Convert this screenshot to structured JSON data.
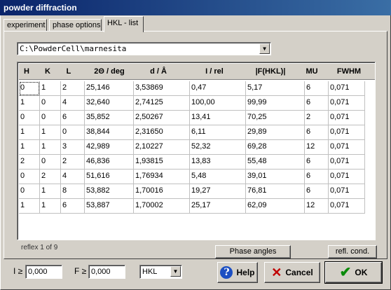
{
  "window": {
    "title": "powder diffraction"
  },
  "tabs": [
    {
      "label": "experiment"
    },
    {
      "label": "phase options"
    },
    {
      "label": "HKL - list"
    }
  ],
  "file_combo": {
    "value": "C:\\PowderCell\\marnesita",
    "icon": "chevron-down-icon"
  },
  "table": {
    "headers": [
      "H",
      "K",
      "L",
      "2Θ / deg",
      "d / Å",
      "I / rel",
      "|F(HKL)|",
      "MU",
      "FWHM"
    ],
    "rows": [
      [
        "0",
        "1",
        "2",
        "25,146",
        "3,53869",
        "0,47",
        "5,17",
        "6",
        "0,071"
      ],
      [
        "1",
        "0",
        "4",
        "32,640",
        "2,74125",
        "100,00",
        "99,99",
        "6",
        "0,071"
      ],
      [
        "0",
        "0",
        "6",
        "35,852",
        "2,50267",
        "13,41",
        "70,25",
        "2",
        "0,071"
      ],
      [
        "1",
        "1",
        "0",
        "38,844",
        "2,31650",
        "6,11",
        "29,89",
        "6",
        "0,071"
      ],
      [
        "1",
        "1",
        "3",
        "42,989",
        "2,10227",
        "52,32",
        "69,28",
        "12",
        "0,071"
      ],
      [
        "2",
        "0",
        "2",
        "46,836",
        "1,93815",
        "13,83",
        "55,48",
        "6",
        "0,071"
      ],
      [
        "0",
        "2",
        "4",
        "51,616",
        "1,76934",
        "5,48",
        "39,01",
        "6",
        "0,071"
      ],
      [
        "0",
        "1",
        "8",
        "53,882",
        "1,70016",
        "19,27",
        "76,81",
        "6",
        "0,071"
      ],
      [
        "1",
        "1",
        "6",
        "53,887",
        "1,70002",
        "25,17",
        "62,09",
        "12",
        "0,071"
      ]
    ]
  },
  "status": {
    "reflex": "reflex  1 of 9"
  },
  "buttons": {
    "phase_angles": "Phase angles",
    "refl_cond": "refl. cond.",
    "help": "Help",
    "cancel": "Cancel",
    "ok": "OK"
  },
  "filters": {
    "i_label": "I ≥",
    "i_value": "0,000",
    "f_label": "F ≥",
    "f_value": "0,000",
    "select_value": "HKL"
  }
}
